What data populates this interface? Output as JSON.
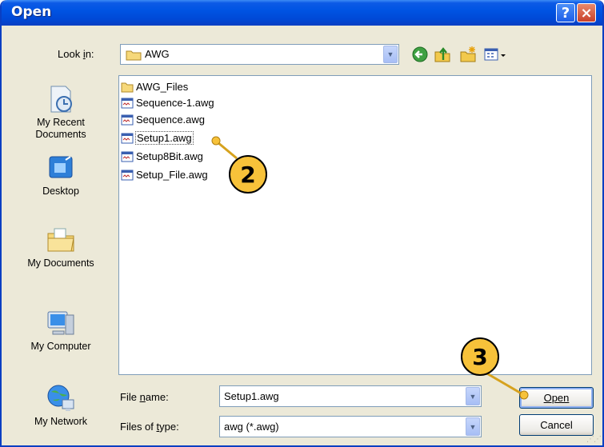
{
  "window": {
    "title": "Open",
    "help_label": "?",
    "close_label": "×"
  },
  "toolbar": {
    "look_in_label": "Look in:",
    "look_in_value": "AWG",
    "icons": [
      "back-icon",
      "up-folder-icon",
      "new-folder-icon",
      "views-menu-icon"
    ]
  },
  "places": [
    {
      "label": "My Recent Documents",
      "icon": "recent-documents-icon"
    },
    {
      "label": "Desktop",
      "icon": "desktop-icon"
    },
    {
      "label": "My Documents",
      "icon": "my-documents-icon"
    },
    {
      "label": "My Computer",
      "icon": "my-computer-icon"
    },
    {
      "label": "My Network",
      "icon": "my-network-icon"
    }
  ],
  "files": [
    {
      "name": "AWG_Files",
      "type": "folder"
    },
    {
      "name": "Sequence-1.awg",
      "type": "file"
    },
    {
      "name": "Sequence.awg",
      "type": "file"
    },
    {
      "name": "Setup1.awg",
      "type": "file",
      "selected": true
    },
    {
      "name": "Setup8Bit.awg",
      "type": "file"
    },
    {
      "name": "Setup_File.awg",
      "type": "file"
    }
  ],
  "form": {
    "file_name_label": "File name:",
    "file_name_value": "Setup1.awg",
    "file_type_label": "Files of type:",
    "file_type_value": "awg (*.awg)"
  },
  "buttons": {
    "open": "Open",
    "cancel": "Cancel"
  },
  "callouts": {
    "step2": "2",
    "step3": "3"
  },
  "colors": {
    "title_bar": "#0054e3",
    "dialog_bg": "#ece9d8",
    "callout_fill": "#f7c23a"
  }
}
